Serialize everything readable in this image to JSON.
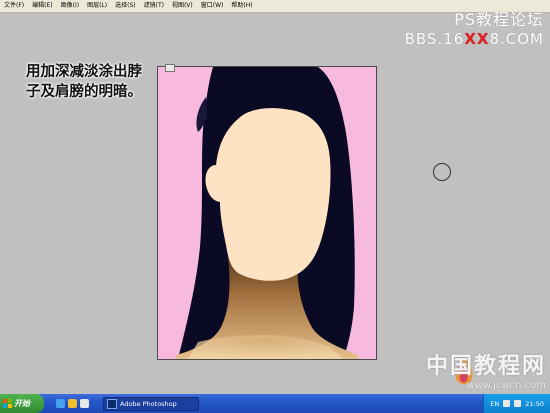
{
  "menu": {
    "items": [
      "文件(F)",
      "编辑(E)",
      "图像(I)",
      "图层(L)",
      "选择(S)",
      "滤镜(T)",
      "视图(V)",
      "窗口(W)",
      "帮助(H)"
    ]
  },
  "watermark_top": {
    "line1": "PS教程论坛",
    "line2_prefix": "BBS.16",
    "line2_red": "XX",
    "line2_suffix": "8.COM"
  },
  "instruction": {
    "line1": "用加深减淡涂出脖",
    "line2": "子及肩膀的明暗。"
  },
  "watermark_bottom": {
    "title": "中国教程网",
    "url": "www.jcwcn.com"
  },
  "taskbar": {
    "start_label": "开始",
    "task_label": "Adobe Photoshop",
    "clock": "21:50",
    "tray_lang": "EN"
  },
  "colors": {
    "canvas_bg": "#f7b9dd",
    "hair": "#0b0a24",
    "skin": "#fde3c4",
    "neck_shadow": "#9c6a3a",
    "workspace": "#c0c0c0"
  }
}
